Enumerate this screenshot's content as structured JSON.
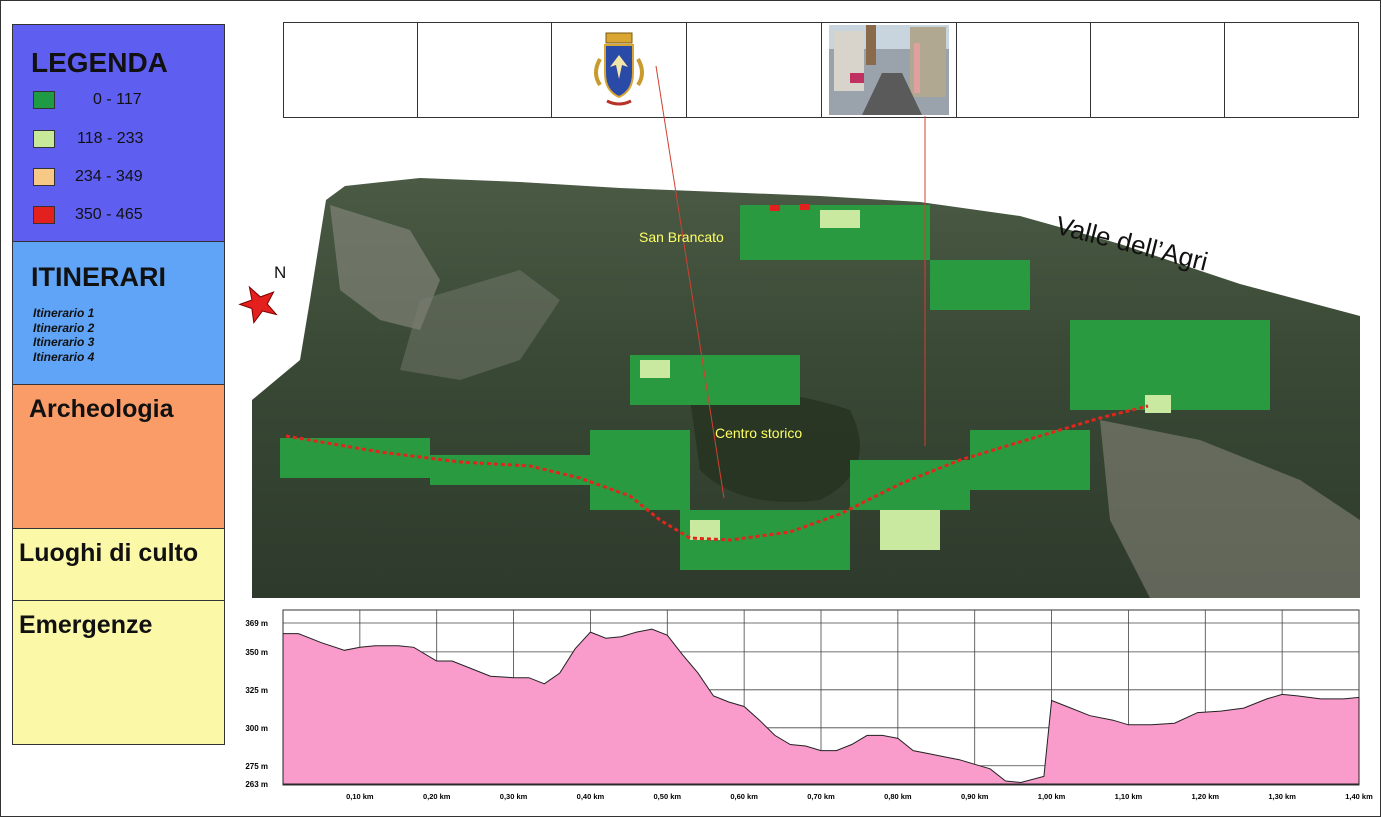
{
  "legend": {
    "title": "LEGENDA",
    "classes": [
      {
        "label": "0 - 117",
        "color": "#1f9a45"
      },
      {
        "label": "118 - 233",
        "color": "#c8e89a"
      },
      {
        "label": "234 - 349",
        "color": "#f7c987"
      },
      {
        "label": "350 - 465",
        "color": "#e3201e"
      }
    ]
  },
  "itinerari": {
    "title": "ITINERARI",
    "items": [
      "Itinerario 1",
      "Itinerario 2",
      "Itinerario 3",
      "Itinerario 4"
    ]
  },
  "sections": {
    "archeologia": "Archeologia",
    "luoghi_di_culto": "Luoghi di culto",
    "emergenze": "Emergenze"
  },
  "map": {
    "north_label": "N",
    "valley_label": "Valle dell’Agri",
    "place_labels": [
      "San Brancato",
      "Centro storico"
    ],
    "route_color": "#e0261c"
  },
  "profile": {
    "y_ticks": [
      "369 m",
      "350 m",
      "325 m",
      "300 m",
      "275 m",
      "263 m"
    ],
    "x_ticks": [
      "0,10 km",
      "0,20 km",
      "0,30 km",
      "0,40 km",
      "0,50 km",
      "0,60 km",
      "0,70 km",
      "0,80 km",
      "0,90 km",
      "1,00 km",
      "1,10 km",
      "1,20 km",
      "1,30 km",
      "1,40 km"
    ],
    "fill_color": "#f99ccc"
  },
  "chart_data": {
    "type": "area",
    "xlabel": "",
    "ylabel": "",
    "xlim": [
      0,
      1.4
    ],
    "ylim": [
      263,
      369
    ],
    "x": [
      0.0,
      0.02,
      0.05,
      0.08,
      0.1,
      0.12,
      0.15,
      0.17,
      0.2,
      0.22,
      0.25,
      0.27,
      0.3,
      0.32,
      0.34,
      0.36,
      0.38,
      0.4,
      0.42,
      0.44,
      0.46,
      0.48,
      0.5,
      0.52,
      0.54,
      0.56,
      0.58,
      0.6,
      0.62,
      0.64,
      0.66,
      0.68,
      0.7,
      0.72,
      0.74,
      0.76,
      0.78,
      0.8,
      0.82,
      0.84,
      0.86,
      0.88,
      0.9,
      0.92,
      0.94,
      0.96,
      0.99,
      1.0,
      1.02,
      1.05,
      1.08,
      1.1,
      1.13,
      1.16,
      1.19,
      1.22,
      1.25,
      1.28,
      1.3,
      1.32,
      1.35,
      1.38,
      1.4
    ],
    "values": [
      362,
      362,
      356,
      351,
      353,
      354,
      354,
      353,
      344,
      344,
      338,
      334,
      333,
      333,
      329,
      336,
      352,
      363,
      359,
      360,
      363,
      365,
      361,
      348,
      336,
      321,
      317,
      314,
      305,
      295,
      289,
      288,
      285,
      285,
      289,
      295,
      295,
      293,
      285,
      283,
      281,
      279,
      276,
      273,
      265,
      264,
      268,
      318,
      314,
      308,
      305,
      302,
      302,
      303,
      310,
      311,
      313,
      319,
      322,
      321,
      319,
      319,
      320
    ]
  }
}
